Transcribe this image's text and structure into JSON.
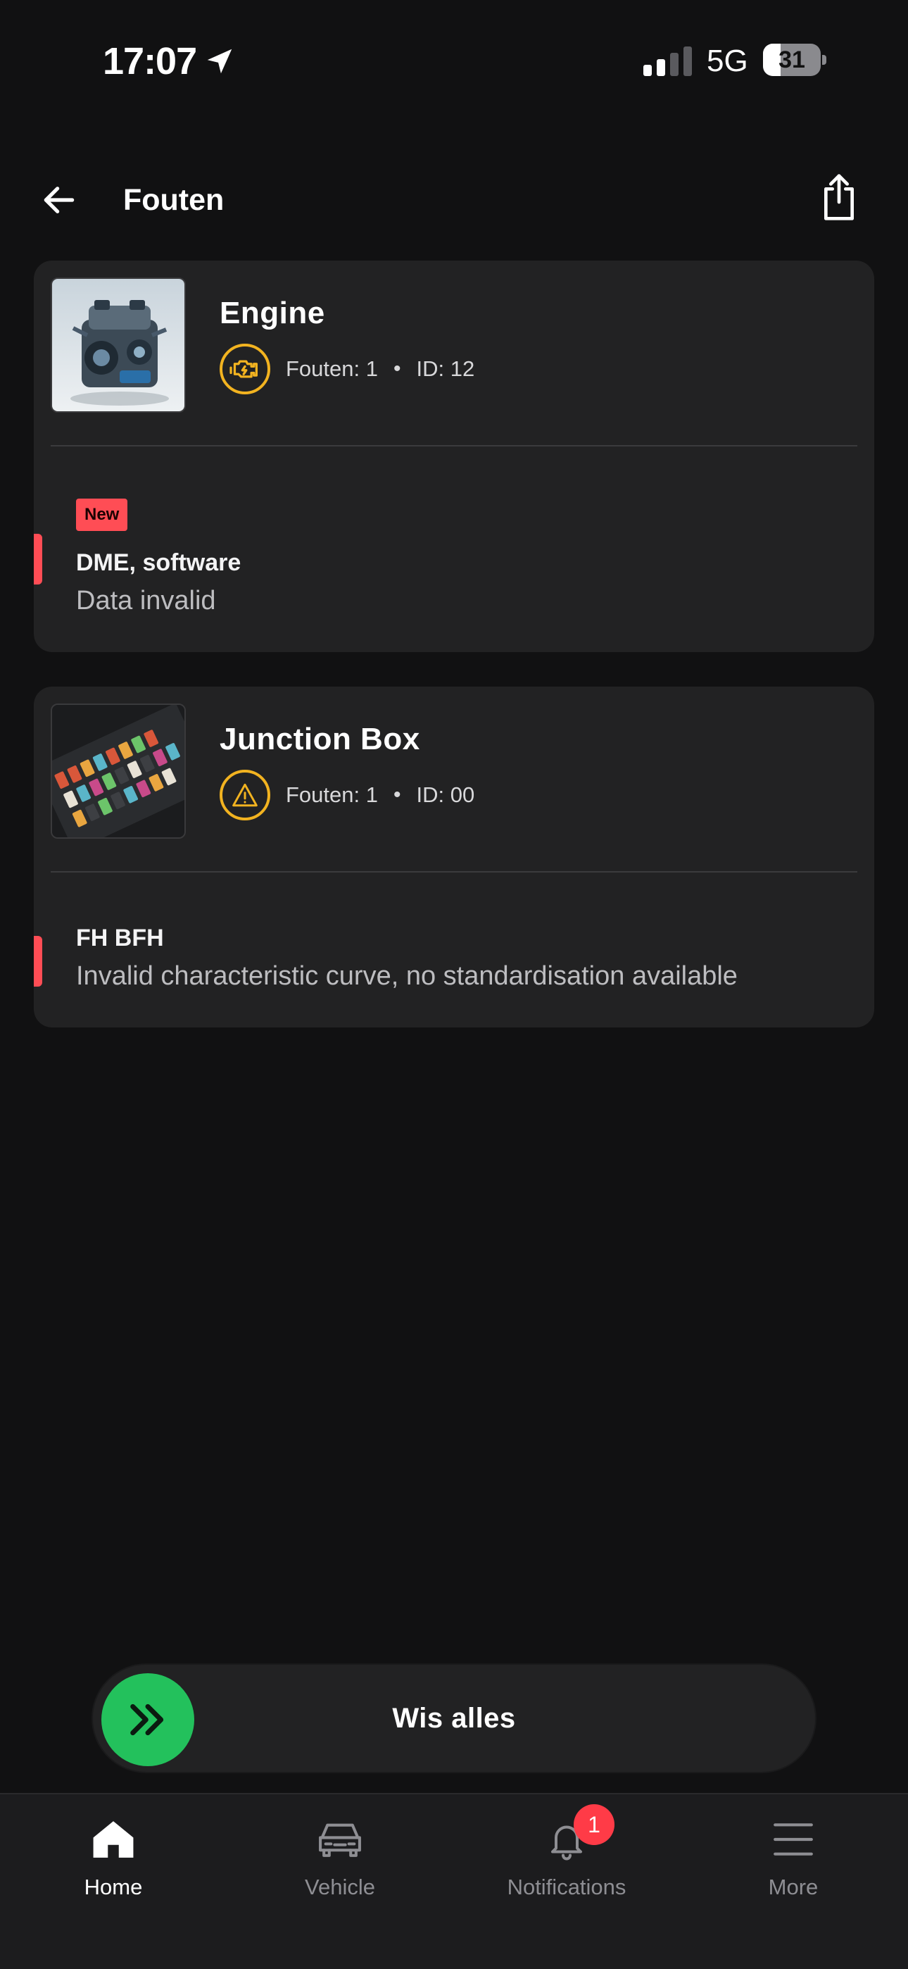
{
  "status_bar": {
    "time": "17:07",
    "network": "5G",
    "battery": "31",
    "battery_level": 0.31
  },
  "header": {
    "title": "Fouten"
  },
  "modules": [
    {
      "name": "Engine",
      "icon": "engine-check-icon",
      "faults_label": "Fouten: 1",
      "id_label": "ID: 12",
      "faults": [
        {
          "badge": "New",
          "title": "DME, software",
          "description": "Data invalid"
        }
      ]
    },
    {
      "name": "Junction Box",
      "icon": "warning-triangle-icon",
      "faults_label": "Fouten: 1",
      "id_label": "ID: 00",
      "faults": [
        {
          "title": "FH BFH",
          "description": "Invalid characteristic curve, no standardisation available"
        }
      ]
    }
  ],
  "swipe_action": {
    "label": "Wis alles"
  },
  "tabbar": {
    "items": [
      {
        "label": "Home",
        "icon": "home-icon",
        "active": true
      },
      {
        "label": "Vehicle",
        "icon": "car-icon",
        "active": false
      },
      {
        "label": "Notifications",
        "icon": "bell-icon",
        "active": false,
        "badge": "1"
      },
      {
        "label": "More",
        "icon": "menu-icon",
        "active": false
      }
    ]
  },
  "colors": {
    "background": "#111112",
    "card": "#222223",
    "accent_yellow": "#f2b320",
    "fault_red": "#ff4d55",
    "swipe_green": "#23c15c"
  }
}
